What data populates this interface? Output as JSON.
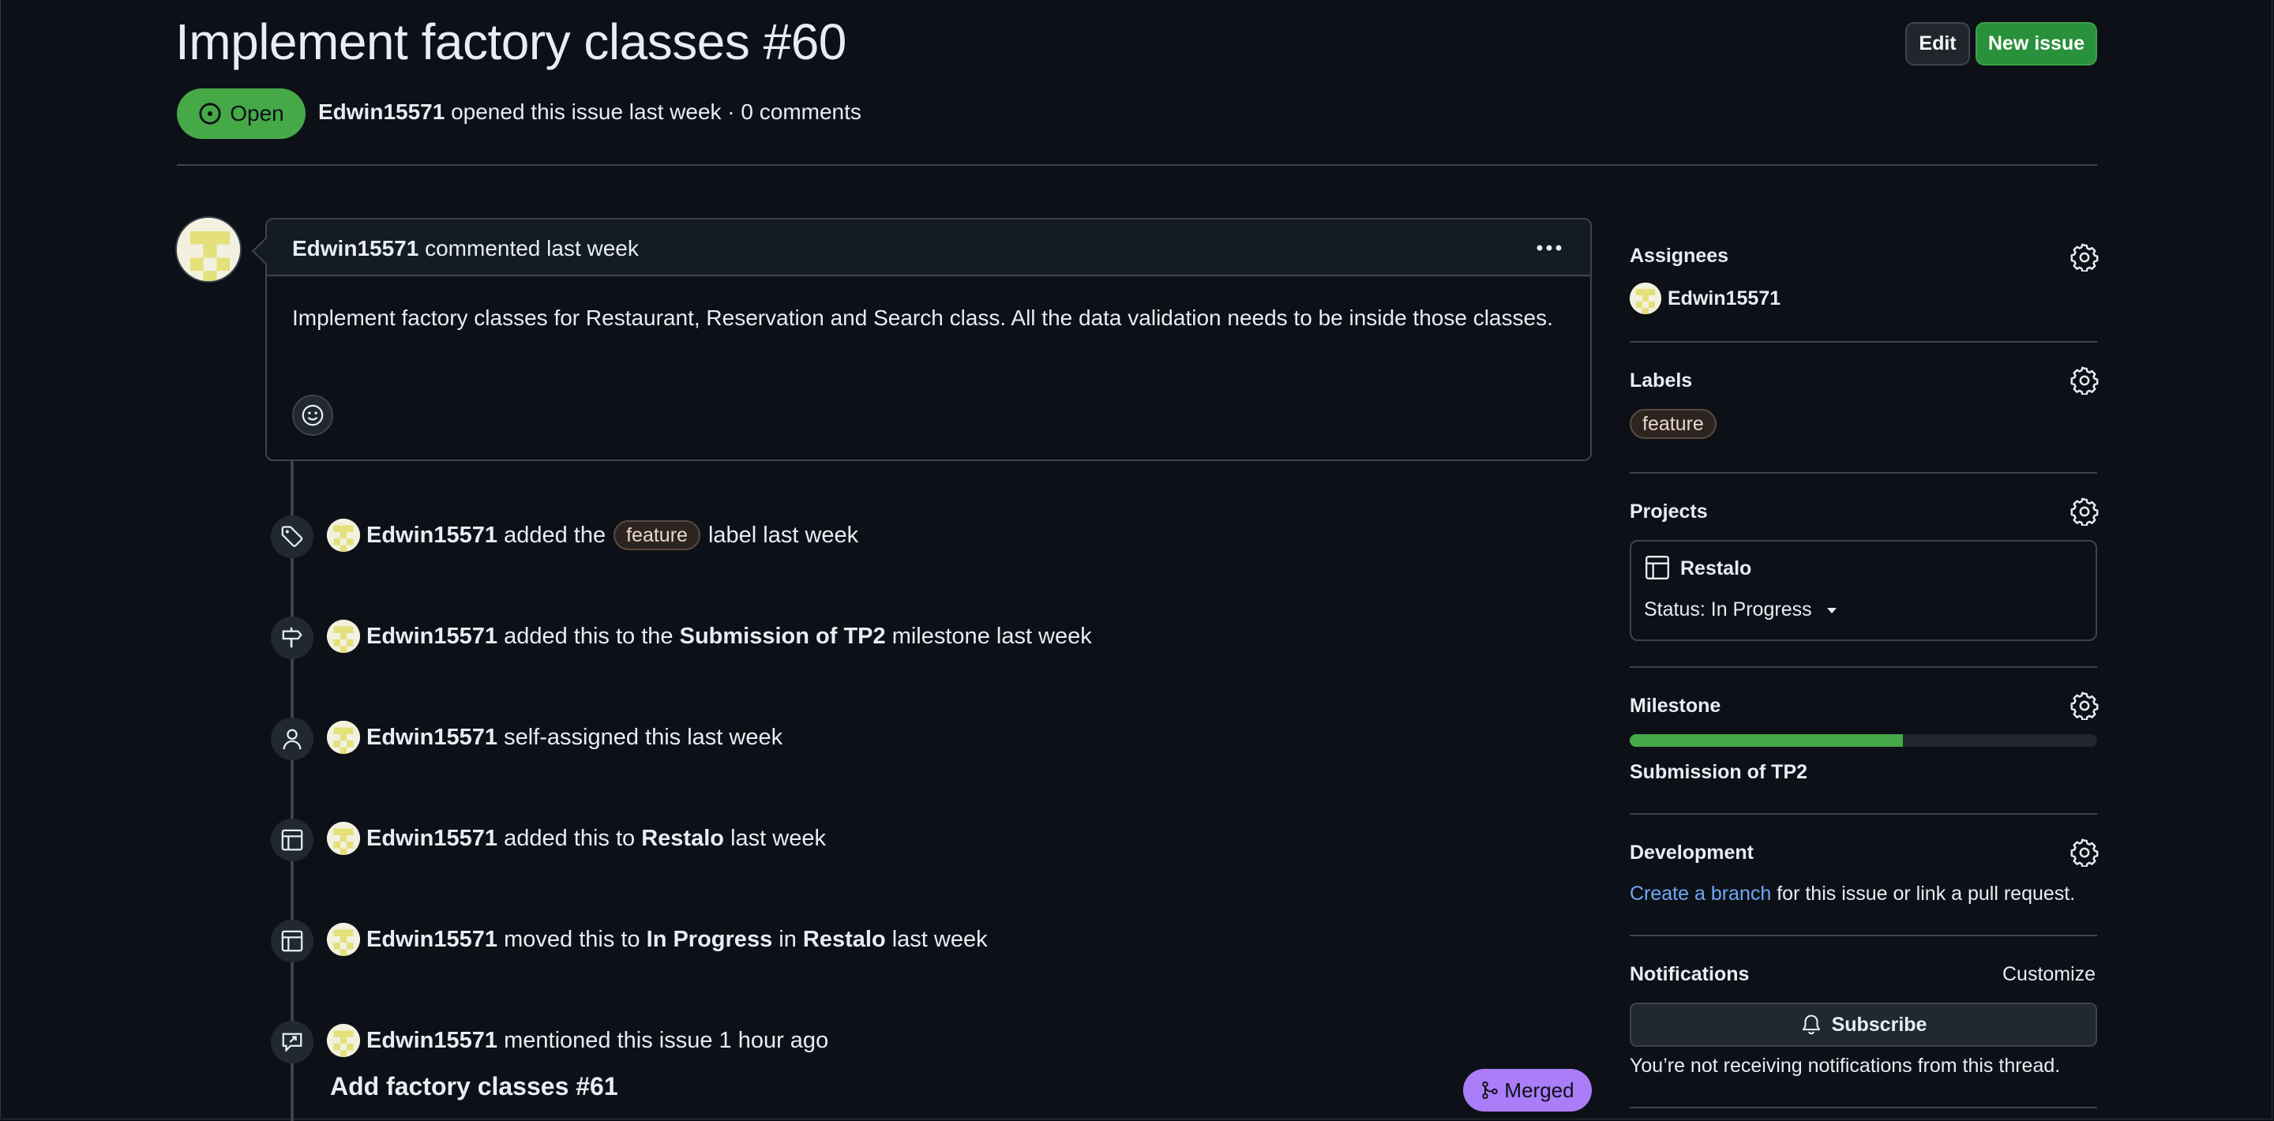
{
  "issue": {
    "title": "Implement factory classes #60",
    "state": "Open",
    "author": "Edwin15571",
    "meta_rest": "opened this issue last week · 0 comments"
  },
  "header_actions": {
    "edit_label": "Edit",
    "new_issue_label": "New issue"
  },
  "comment": {
    "author": "Edwin15571",
    "when": "commented last week",
    "body": "Implement factory classes for Restaurant, Reservation and Search class. All the data validation needs to be inside those classes."
  },
  "timeline": {
    "ev1": {
      "icon": "tag-icon",
      "actor": "Edwin15571",
      "pre": "added the",
      "label": "feature",
      "post": "label last week"
    },
    "ev2": {
      "icon": "milestone-icon",
      "actor": "Edwin15571",
      "pre": "added this to the",
      "strong": "Submission of TP2",
      "post": "milestone last week"
    },
    "ev3": {
      "icon": "person-icon",
      "actor": "Edwin15571",
      "text": "self-assigned this last week"
    },
    "ev4": {
      "icon": "project-icon",
      "actor": "Edwin15571",
      "pre": "added this to",
      "strong": "Restalo",
      "post": "last week"
    },
    "ev5": {
      "icon": "project-icon",
      "actor": "Edwin15571",
      "pre": "moved this to",
      "strong": "In Progress",
      "mid": "in",
      "strong2": "Restalo",
      "post": "last week"
    },
    "ev6": {
      "icon": "cross-reference-icon",
      "actor": "Edwin15571",
      "text": "mentioned this issue 1 hour ago"
    },
    "pr": {
      "title": "Add factory classes #61",
      "status": "Merged"
    }
  },
  "sidebar": {
    "assignees": {
      "heading": "Assignees",
      "user": "Edwin15571"
    },
    "labels": {
      "heading": "Labels",
      "label": "feature"
    },
    "projects": {
      "heading": "Projects",
      "name": "Restalo",
      "status": "Status: In Progress"
    },
    "milestone": {
      "heading": "Milestone",
      "name": "Submission of TP2",
      "progress_fraction": 0.585
    },
    "development": {
      "heading": "Development",
      "link": "Create a branch",
      "rest": "for this issue or link a pull request."
    },
    "notifications": {
      "heading": "Notifications",
      "customize": "Customize",
      "subscribe": "Subscribe",
      "note": "You’re not receiving notifications from this thread."
    }
  },
  "colors": {
    "background": "#0d1117",
    "open": "#46a948",
    "merged": "#ab7df8",
    "link": "#6fa8f7",
    "label_bg": "#2c2421"
  }
}
